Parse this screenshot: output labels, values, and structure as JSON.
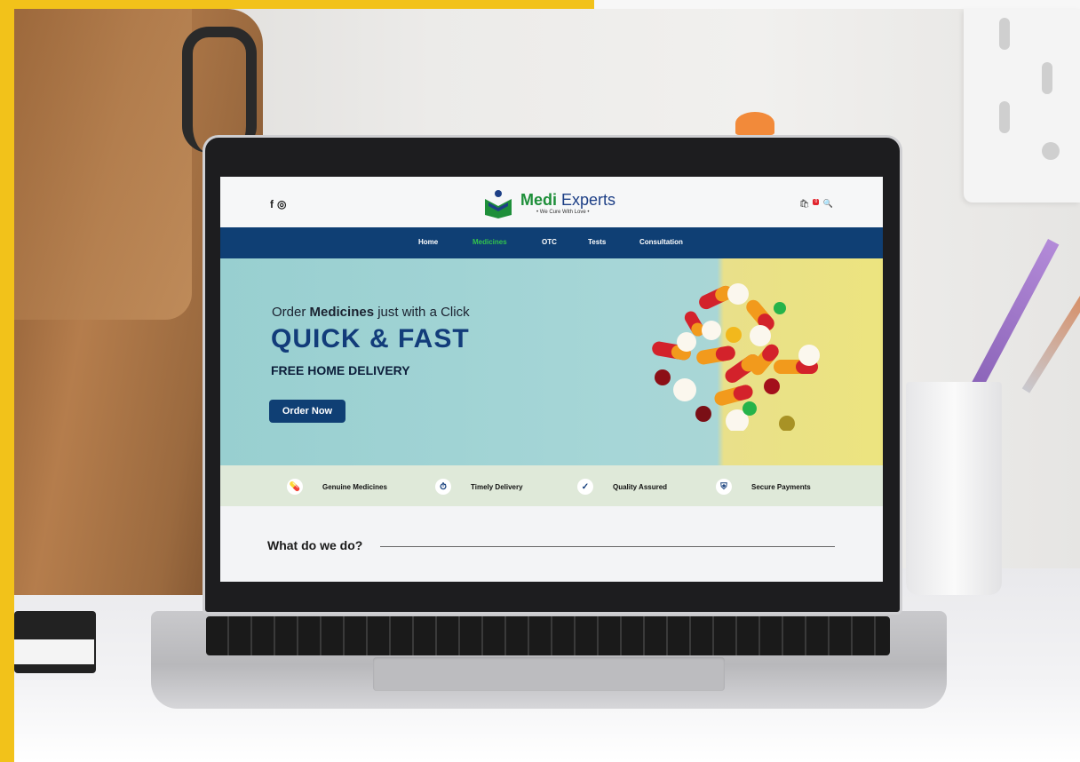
{
  "header": {
    "social_icons": [
      "facebook-icon",
      "instagram-icon"
    ],
    "facebook_glyph": "f",
    "instagram_glyph": "◎",
    "brand": {
      "name_part1": "Medi",
      "name_part2": "Experts",
      "tagline": "• We Cure With Love •"
    },
    "cart_count": "0",
    "cart_glyph": "🛍",
    "search_glyph": "🔍"
  },
  "nav": {
    "items": [
      "Home",
      "Medicines",
      "OTC",
      "Tests",
      "Consultation"
    ],
    "active": "Medicines"
  },
  "hero": {
    "line1_pre": "Order",
    "line1_bold": "Medicines",
    "line1_post": "just with a Click",
    "title": "QUICK & FAST",
    "subtitle": "FREE HOME DELIVERY",
    "button": "Order Now"
  },
  "features": [
    {
      "label": "Genuine Medicines",
      "icon": "pills-icon",
      "glyph": "💊"
    },
    {
      "label": "Timely Delivery",
      "icon": "stopwatch-icon",
      "glyph": "⏱"
    },
    {
      "label": "Quality Assured",
      "icon": "check-badge-icon",
      "glyph": "✓"
    },
    {
      "label": "Secure Payments",
      "icon": "shield-icon",
      "glyph": "⛨"
    }
  ],
  "section": {
    "title": "What do we do?"
  },
  "colors": {
    "nav_bg": "#0f3f74",
    "nav_active": "#33c34c",
    "brand_green": "#1e8f3a",
    "brand_blue": "#1d3f86",
    "accent_yellow": "#f2c21a"
  }
}
